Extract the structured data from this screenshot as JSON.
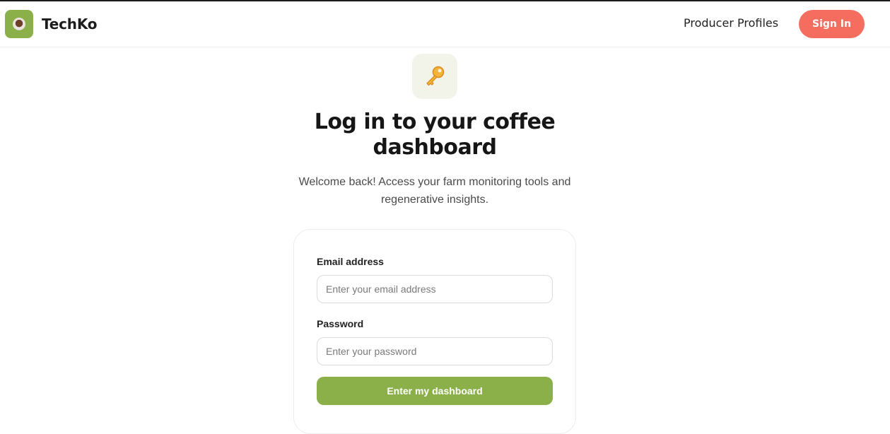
{
  "brand": {
    "name": "TechKo",
    "logo_icon": "coffee-cup-icon"
  },
  "nav": {
    "producer_profiles": "Producer Profiles",
    "sign_in": "Sign In"
  },
  "hero": {
    "icon": "key-icon",
    "title_line1": "Log in to your coffee",
    "title_line2": "dashboard",
    "subtitle_line1": "Welcome back! Access your farm monitoring tools and",
    "subtitle_line2": "regenerative insights."
  },
  "form": {
    "email_label": "Email address",
    "email_placeholder": "Enter your email address",
    "email_value": "",
    "password_label": "Password",
    "password_placeholder": "Enter your password",
    "password_value": "",
    "submit_label": "Enter my dashboard"
  },
  "colors": {
    "brand_green": "#8bb04a",
    "accent_coral": "#f56d5f",
    "key_badge_bg": "#f2f3e9"
  }
}
